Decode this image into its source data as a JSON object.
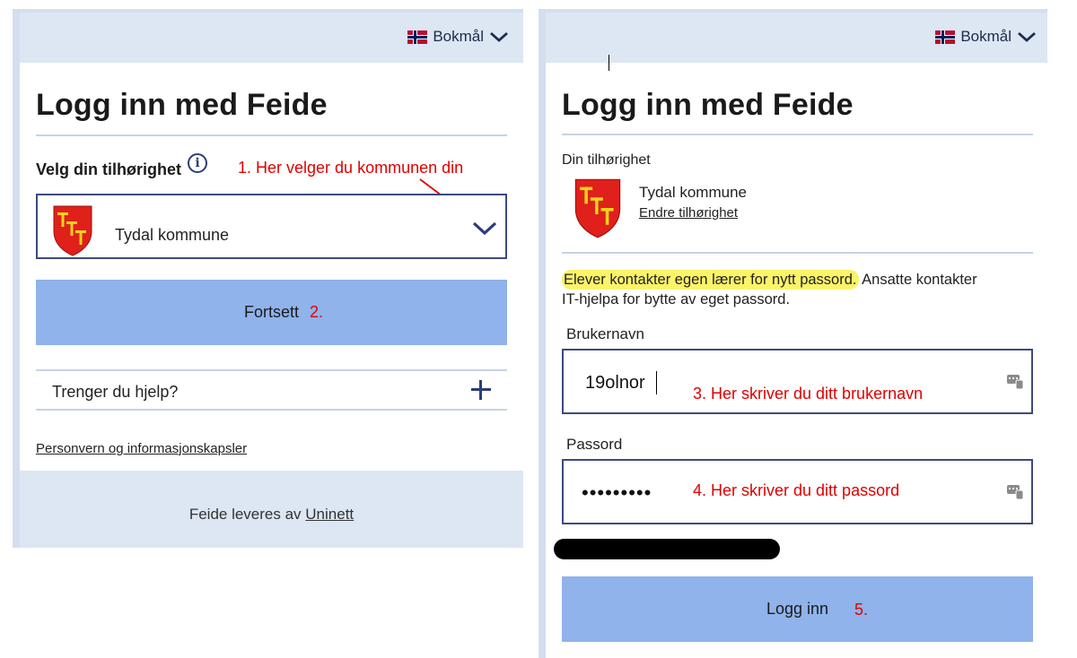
{
  "left": {
    "language": "Bokmål",
    "title": "Logg inn med Feide",
    "affiliation_label": "Velg din tilhørighet",
    "info_glyph": "i",
    "annotation_1": "1.   Her velger du kommunen din",
    "selected_org": "Tydal kommune",
    "continue_button": "Fortsett",
    "annotation_2": "2.",
    "help_label": "Trenger du hjelp?",
    "privacy_link": "Personvern og informasjonskapsler",
    "footer_prefix": "Feide leveres av ",
    "footer_link": "Uninett"
  },
  "right": {
    "language": "Bokmål",
    "title": "Logg inn med Feide",
    "affiliation_heading": "Din tilhørighet",
    "org_name": "Tydal kommune",
    "change_link": "Endre tilhørighet",
    "notice_highlight": "Elever kontakter egen lærer for nytt passord.",
    "notice_rest_1": " Ansatte kontakter",
    "notice_rest_2": "IT-hjelpa for bytte av eget passord.",
    "username_label": "Brukernavn",
    "username_value": "19olnor",
    "annotation_3": "3.    Her skriver du ditt brukernavn",
    "password_label": "Passord",
    "password_value": "•••••••••",
    "annotation_4": "4.    Her skriver du ditt passord",
    "login_button": "Logg inn",
    "annotation_5": "5."
  },
  "colors": {
    "accent_button": "#8fb3ea",
    "topbar": "#dde6f3",
    "annotation": "#e00000",
    "border": "#3c4a7e",
    "highlight": "#fbf36a"
  },
  "icons": [
    "flag-norway-icon",
    "chevron-down-icon",
    "info-icon",
    "coat-of-arms-icon",
    "plus-icon",
    "keyboard-icon",
    "annotation-arrow-icon"
  ]
}
